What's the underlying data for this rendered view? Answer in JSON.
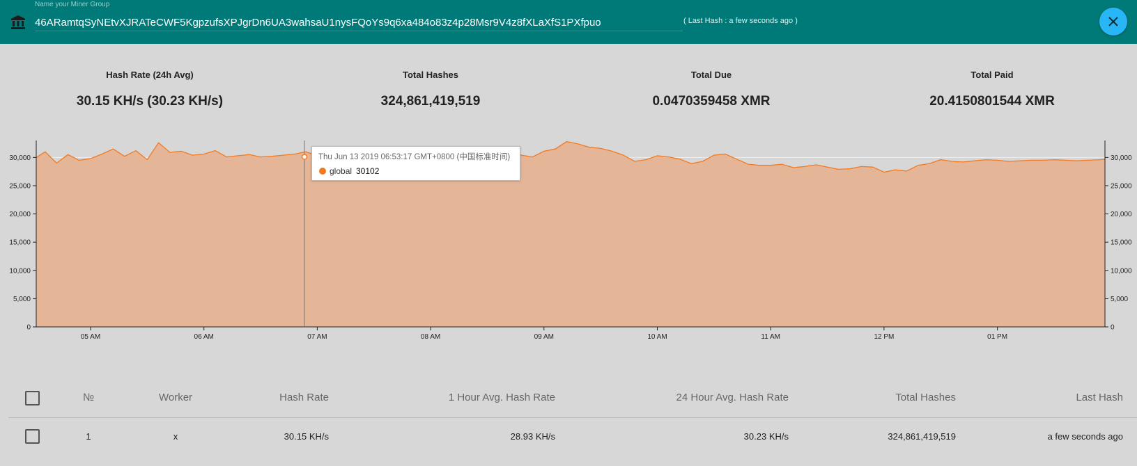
{
  "header": {
    "field_label": "Name your Miner Group",
    "address": "46ARamtqSyNEtvXJRATeCWF5KgpzufsXPJgrDn6UA3wahsaU1nysFQoYs9q6xa484o83z4p28Msr9V4z8fXLaXfS1PXfpuo",
    "last_hash_note": "( Last Hash : a few seconds ago )",
    "close_icon": "close-icon",
    "bank_icon": "bank-icon",
    "accent_color": "#007a78"
  },
  "stats": [
    {
      "label": "Hash Rate (24h Avg)",
      "value": "30.15 KH/s (30.23 KH/s)"
    },
    {
      "label": "Total Hashes",
      "value": "324,861,419,519"
    },
    {
      "label": "Total Due",
      "value": "0.0470359458 XMR"
    },
    {
      "label": "Total Paid",
      "value": "20.4150801544 XMR"
    }
  ],
  "tooltip": {
    "title": "Thu Jun 13 2019 06:53:17 GMT+0800 (中国标准时间)",
    "series": "global",
    "value": "30102"
  },
  "chart_data": {
    "type": "area",
    "series": [
      {
        "name": "global",
        "color": "#f47920",
        "fill": "#e4b697"
      }
    ],
    "x_ticks": [
      "05 AM",
      "06 AM",
      "07 AM",
      "08 AM",
      "09 AM",
      "10 AM",
      "11 AM",
      "12 PM",
      "01 PM"
    ],
    "y_ticks": [
      "0",
      "5,000",
      "10,000",
      "15,000",
      "20,000",
      "25,000",
      "30,000"
    ],
    "ylim": [
      0,
      33000
    ],
    "grid": true,
    "x_hours": [
      4.52,
      4.6,
      4.7,
      4.8,
      4.9,
      5.0,
      5.1,
      5.2,
      5.3,
      5.4,
      5.5,
      5.6,
      5.7,
      5.8,
      5.9,
      6.0,
      6.1,
      6.2,
      6.3,
      6.4,
      6.5,
      6.6,
      6.7,
      6.8,
      6.9,
      7.0,
      7.1,
      7.2,
      7.3,
      7.4,
      7.5,
      7.6,
      7.7,
      7.8,
      7.9,
      8.0,
      8.1,
      8.2,
      8.3,
      8.4,
      8.5,
      8.6,
      8.7,
      8.8,
      8.9,
      9.0,
      9.1,
      9.2,
      9.3,
      9.4,
      9.5,
      9.6,
      9.7,
      9.8,
      9.9,
      10.0,
      10.1,
      10.2,
      10.3,
      10.4,
      10.5,
      10.6,
      10.7,
      10.8,
      10.9,
      11.0,
      11.1,
      11.2,
      11.3,
      11.4,
      11.5,
      11.6,
      11.7,
      11.8,
      11.9,
      12.0,
      12.1,
      12.2,
      12.3,
      12.4,
      12.5,
      12.6,
      12.7,
      12.8,
      12.9,
      13.0,
      13.1,
      13.2,
      13.3,
      13.4,
      13.5,
      13.6,
      13.7,
      13.8,
      13.9,
      14.0,
      14.05
    ],
    "y_values": [
      30000,
      31000,
      29000,
      30500,
      29500,
      29800,
      30600,
      31500,
      30200,
      31200,
      29600,
      32600,
      30900,
      31100,
      30400,
      30600,
      31200,
      30100,
      30300,
      30500,
      30100,
      30200,
      30400,
      30600,
      31000,
      30300,
      30100,
      30700,
      29800,
      30200,
      29700,
      30000,
      31900,
      30600,
      29700,
      30300,
      31600,
      31000,
      30800,
      31400,
      30900,
      31100,
      31600,
      30400,
      30100,
      31100,
      31500,
      32800,
      32400,
      31800,
      31600,
      31100,
      30400,
      29300,
      29600,
      30300,
      30100,
      29700,
      28900,
      29300,
      30400,
      30600,
      29700,
      28800,
      28600,
      28600,
      28800,
      28200,
      28400,
      28700,
      28300,
      27900,
      28000,
      28400,
      28300,
      27400,
      27800,
      27600,
      28600,
      28900,
      29600,
      29300,
      29200,
      29400,
      29600,
      29500,
      29300,
      29400,
      29500,
      29500,
      29600,
      29500,
      29400,
      29500,
      29600,
      29700,
      29500
    ]
  },
  "table": {
    "headers": [
      "№",
      "Worker",
      "Hash Rate",
      "1 Hour Avg. Hash Rate",
      "24 Hour Avg. Hash Rate",
      "Total Hashes",
      "Last Hash"
    ],
    "rows": [
      {
        "no": "1",
        "worker": "x",
        "hash_rate": "30.15 KH/s",
        "avg_1h": "28.93 KH/s",
        "avg_24h": "30.23 KH/s",
        "total": "324,861,419,519",
        "last": "a few seconds ago"
      }
    ]
  }
}
